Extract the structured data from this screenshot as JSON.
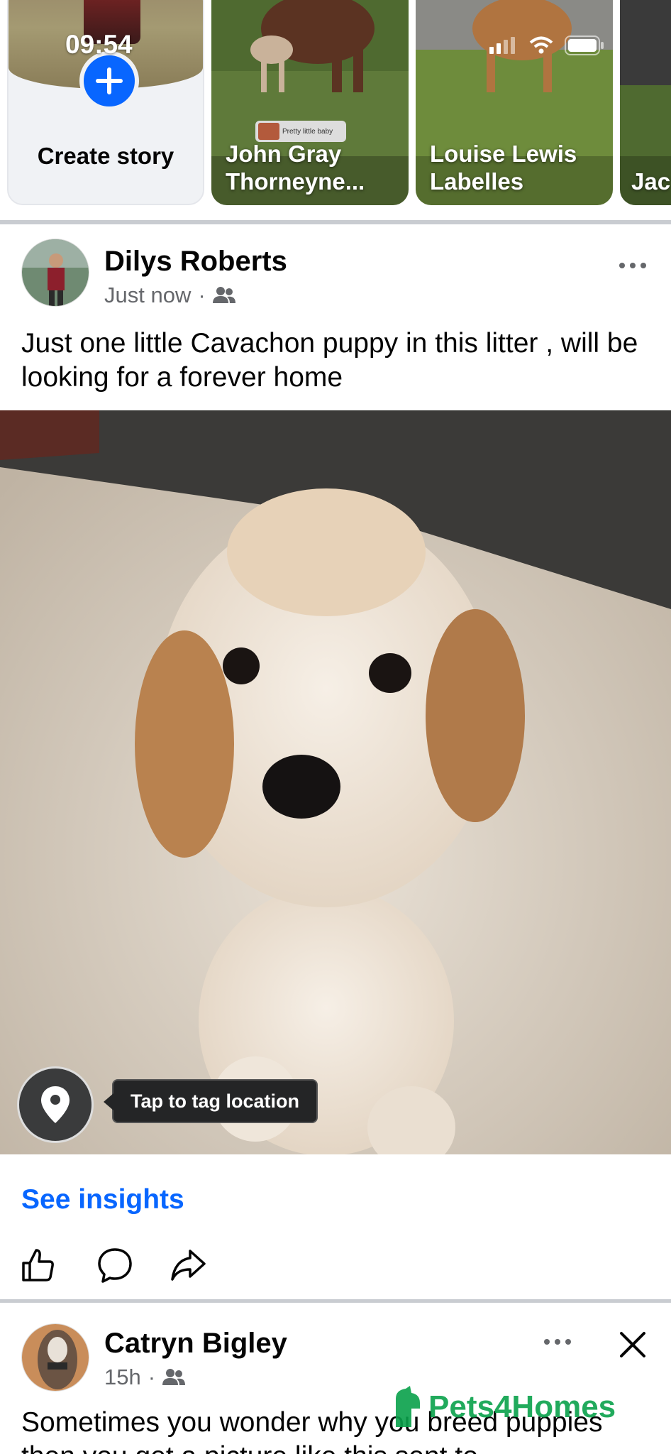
{
  "status_bar": {
    "time": "09:54"
  },
  "stories": {
    "create_label": "Create story",
    "items": [
      {
        "name": "John Gray Thorneyne...",
        "caption": "Pretty little baby"
      },
      {
        "name": "Louise Lewis Labelles"
      },
      {
        "name": "Jac"
      }
    ]
  },
  "post1": {
    "author": "Dilys Roberts",
    "time": "Just now",
    "text": "Just one little Cavachon puppy in this litter , will be looking for a forever home",
    "location_tip": "Tap to tag location",
    "insights_label": "See insights"
  },
  "post2": {
    "author": "Catryn Bigley",
    "time": "15h",
    "text": "Sometimes you wonder why you breed puppies then you get a picture like this sent to"
  },
  "watermark": {
    "text": "Pets4Homes"
  },
  "colors": {
    "accent": "#0866ff",
    "secondary_text": "#65676b",
    "divider": "#c9ccd1"
  }
}
